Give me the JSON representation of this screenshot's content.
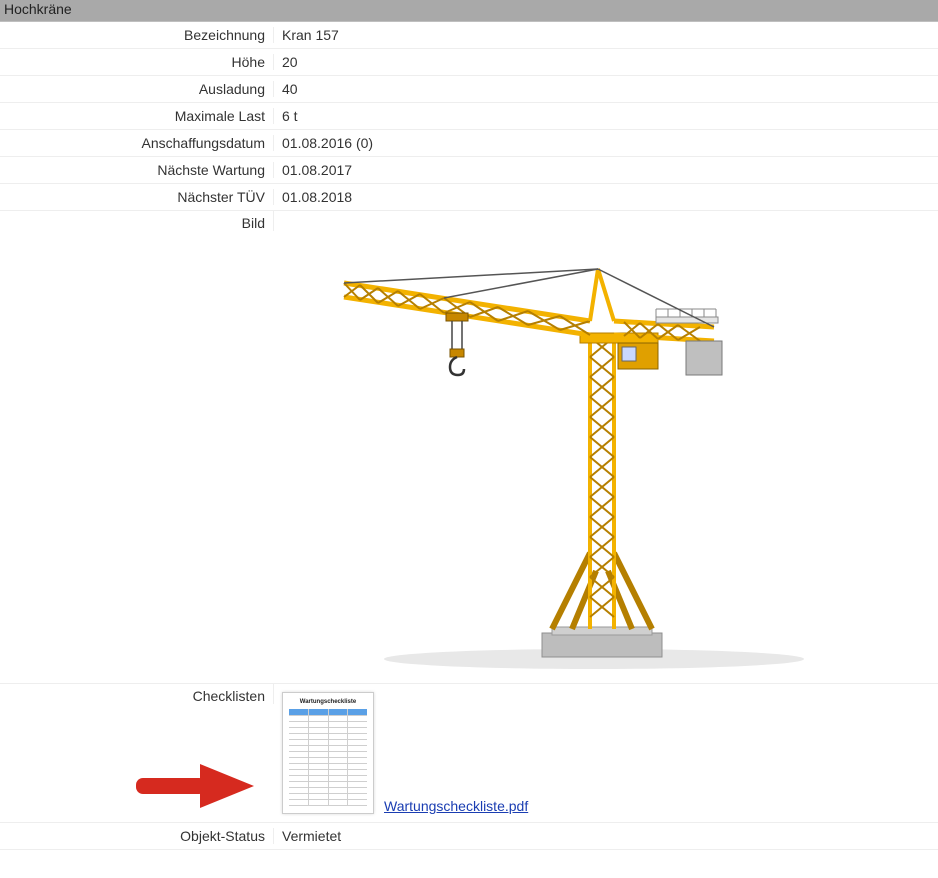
{
  "header": {
    "title": "Hochkräne"
  },
  "fields": {
    "bezeichnung": {
      "label": "Bezeichnung",
      "value": "Kran 157"
    },
    "hoehe": {
      "label": "Höhe",
      "value": "20"
    },
    "ausladung": {
      "label": "Ausladung",
      "value": "40"
    },
    "maxlast": {
      "label": "Maximale Last",
      "value": "6 t"
    },
    "anschaffung": {
      "label": "Anschaffungsdatum",
      "value": "01.08.2016 (0)"
    },
    "wartung": {
      "label": "Nächste Wartung",
      "value": "01.08.2017"
    },
    "tuev": {
      "label": "Nächster TÜV",
      "value": "01.08.2018"
    },
    "bild": {
      "label": "Bild"
    },
    "checklisten": {
      "label": "Checklisten",
      "file": "Wartungscheckliste.pdf",
      "thumb_title": "Wartungscheckliste"
    },
    "status": {
      "label": "Objekt-Status",
      "value": "Vermietet"
    }
  },
  "colors": {
    "crane": "#f3b200",
    "crane_dark": "#b57f00",
    "base": "#bdbdbd",
    "arrow": "#d62a1f",
    "link": "#1a3db2"
  }
}
